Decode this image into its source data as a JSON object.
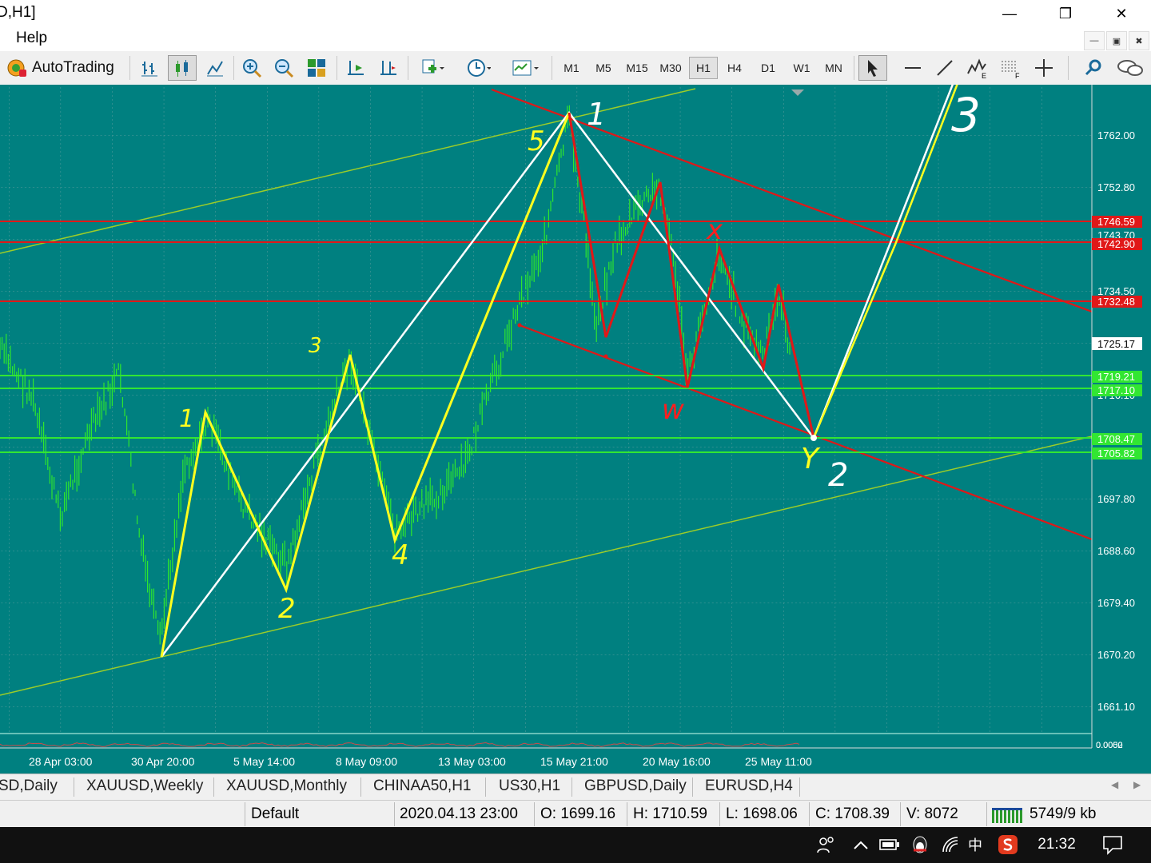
{
  "window": {
    "title": "D,H1]",
    "minimize": "—",
    "restore": "❐",
    "close": "✕"
  },
  "menu": {
    "help": "Help",
    "mdi_min": "—",
    "mdi_restore": "▣",
    "mdi_close": "✖"
  },
  "toolbar": {
    "autotrading": "AutoTrading",
    "timeframes": [
      "M1",
      "M5",
      "M15",
      "M30",
      "H1",
      "H4",
      "D1",
      "W1",
      "MN"
    ],
    "active_timeframe": "H1"
  },
  "chart": {
    "price_labels": [
      "1762.00",
      "1752.80",
      "1734.50",
      "1725.17",
      "1697.80",
      "1688.60",
      "1679.40",
      "1670.20",
      "1661.10"
    ],
    "hline_labels": {
      "r1": "1746.59",
      "r2": "1742.90",
      "r3": "1732.48",
      "g1": "1719.21",
      "g2": "1717.10",
      "g3": "1708.47",
      "g4": "1705.82"
    },
    "hidden_label": "1743.70",
    "hidden_label2": "1716.10",
    "indicator_labels": [
      "0.0052",
      "0.0000"
    ],
    "time_labels": [
      "28 Apr 03:00",
      "30 Apr 20:00",
      "5 May 14:00",
      "8 May 09:00",
      "13 May 03:00",
      "15 May 21:00",
      "20 May 16:00",
      "25 May 11:00"
    ],
    "annotations": {
      "one": "1",
      "two": "2",
      "three": "3",
      "four": "4",
      "five": "5",
      "wave1": "1",
      "wave2": "2",
      "wave3": "3",
      "w": "w",
      "x": "x",
      "y": "Y"
    },
    "colors": {
      "background": "#008080",
      "candles": "#2ee62e",
      "support": "#32e632",
      "resistance": "#e01818",
      "impulse": "#ffff1e",
      "overlay": "#ffffff"
    }
  },
  "tabs": [
    "SD,Daily",
    "XAUUSD,Weekly",
    "XAUUSD,Monthly",
    "CHINAA50,H1",
    "US30,H1",
    "GBPUSD,Daily",
    "EURUSD,H4"
  ],
  "status": {
    "profile": "Default",
    "datetime": "2020.04.13 23:00",
    "open": "O: 1699.16",
    "high": "H: 1710.59",
    "low": "L: 1698.06",
    "close": "C: 1708.39",
    "volume": "V: 8072",
    "traffic": "5749/9 kb"
  },
  "taskbar": {
    "ime": "中",
    "time": "21:32"
  }
}
